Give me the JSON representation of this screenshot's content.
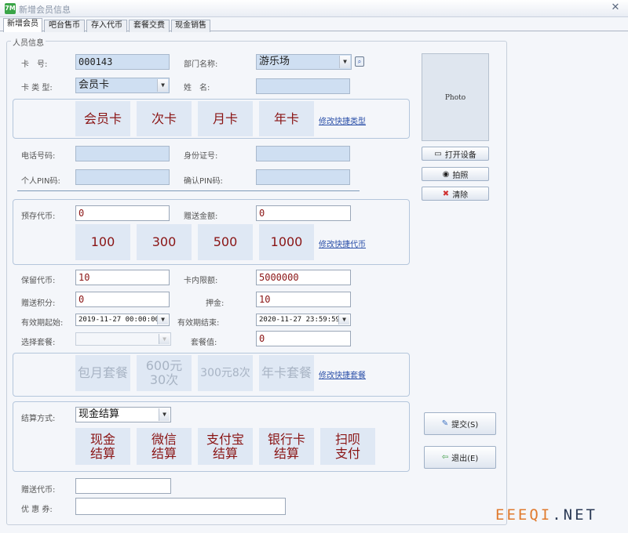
{
  "window": {
    "title": "新增会员信息",
    "icon_text": "7M"
  },
  "tabs": [
    {
      "label": "新增会员"
    },
    {
      "label": "吧台售币"
    },
    {
      "label": "存入代币"
    },
    {
      "label": "套餐交费"
    },
    {
      "label": "现金销售"
    }
  ],
  "group_label": "人员信息",
  "basic": {
    "card_no_label": "卡　号:",
    "card_no": "000143",
    "dept_label": "部门名称:",
    "dept_value": "游乐场",
    "card_type_label": "卡 类 型:",
    "card_type_value": "会员卡",
    "name_label": "姓　名:",
    "name_value": ""
  },
  "card_types": {
    "tiles": [
      "会员卡",
      "次卡",
      "月卡",
      "年卡"
    ],
    "edit_link": "修改快捷类型"
  },
  "contact": {
    "phone_label": "电话号码:",
    "id_label": "身份证号:",
    "pin_label": "个人PIN码:",
    "pin_confirm_label": "确认PIN码:"
  },
  "deposit": {
    "prestore_label": "预存代币:",
    "prestore_value": "0",
    "gift_label": "赠送金额:",
    "gift_value": "0",
    "tiles": [
      "100",
      "300",
      "500",
      "1000"
    ],
    "edit_link": "修改快捷代币"
  },
  "misc": {
    "reserve_label": "保留代币:",
    "reserve_value": "10",
    "limit_label": "卡内限额:",
    "limit_value": "5000000",
    "points_label": "赠送积分:",
    "points_value": "0",
    "deposit_label": "押金:",
    "deposit_value": "10",
    "valid_from_label": "有效期起始:",
    "valid_from": "2019-11-27 00:00:00",
    "valid_to_label": "有效期结束:",
    "valid_to": "2020-11-27 23:59:59",
    "package_label": "选择套餐:",
    "package_value": "",
    "package_amount_label": "套餐值:",
    "package_amount": "0"
  },
  "packages": {
    "tiles": [
      "包月套餐",
      "600元30次",
      "300元8次",
      "年卡套餐"
    ],
    "edit_link": "修改快捷套餐"
  },
  "payment": {
    "method_label": "结算方式:",
    "method_value": "现金结算",
    "tiles": [
      "现金结算",
      "微信结算",
      "支付宝结算",
      "银行卡结算",
      "扫呗支付"
    ]
  },
  "bottom": {
    "gift_tokens_label": "赠送代币:",
    "coupon_label": "优 惠 券:"
  },
  "side": {
    "photo": "Photo",
    "open_device": "打开设备",
    "take_photo": "拍照",
    "clear": "清除",
    "submit": "提交(S)",
    "exit": "退出(E)"
  },
  "watermark": {
    "part1": "EEEQI",
    "part2": ".NET"
  },
  "colors": {
    "tile_bg": "#dfe8f4",
    "tile_text": "#8a1414",
    "link": "#2a4fa8",
    "field_blue": "#cfdff2"
  }
}
